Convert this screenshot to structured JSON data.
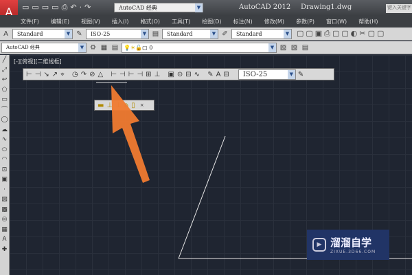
{
  "title": {
    "app": "AutoCAD 2012",
    "file": "Drawing1.dwg",
    "workspace": "AutoCAD 经典",
    "search_placeholder": "键入关键字"
  },
  "menu": [
    "文件(F)",
    "编辑(E)",
    "视图(V)",
    "插入(I)",
    "格式(O)",
    "工具(T)",
    "绘图(D)",
    "标注(N)",
    "修改(M)",
    "参数(P)",
    "窗口(W)",
    "帮助(H)"
  ],
  "styles": {
    "text_style": "Standard",
    "dim_style": "ISO-25",
    "table_style": "Standard",
    "multileader_style": "Standard"
  },
  "layers": {
    "workspace": "AutoCAD 经典",
    "current_layer": "0"
  },
  "viewport_label": "[-][俯视][二维线框]",
  "dim_toolbar": {
    "dim_style": "ISO-25"
  },
  "watermark": {
    "name": "溜溜自学",
    "url": "ZIXUE.3D66.COM"
  },
  "colors": {
    "canvas": "#1f2531",
    "arrow": "#f07a30",
    "accent_logo": "#c0242a"
  }
}
